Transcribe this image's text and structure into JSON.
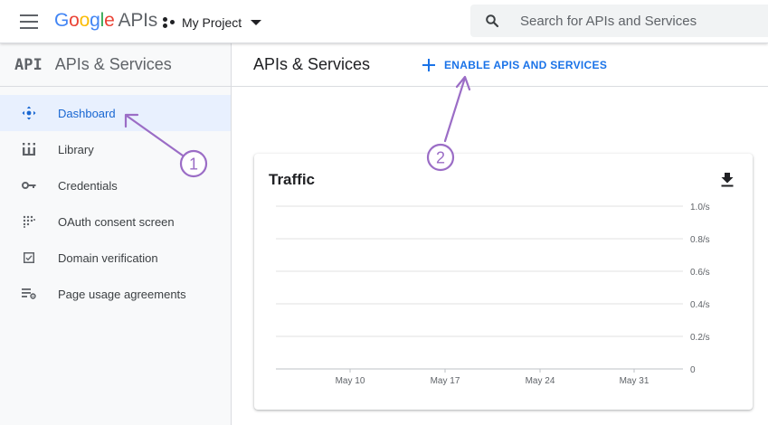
{
  "header": {
    "logo": {
      "letters": [
        "G",
        "o",
        "o",
        "g",
        "l",
        "e"
      ],
      "suffix": "APIs"
    },
    "project": {
      "name": "My Project"
    },
    "search": {
      "placeholder": "Search for APIs and Services",
      "value": ""
    }
  },
  "sidebar": {
    "logo_text": "API",
    "title": "APIs & Services",
    "items": [
      {
        "label": "Dashboard",
        "icon": "dashboard-icon",
        "active": true
      },
      {
        "label": "Library",
        "icon": "library-icon",
        "active": false
      },
      {
        "label": "Credentials",
        "icon": "key-icon",
        "active": false
      },
      {
        "label": "OAuth consent screen",
        "icon": "consent-icon",
        "active": false
      },
      {
        "label": "Domain verification",
        "icon": "checkbox-icon",
        "active": false
      },
      {
        "label": "Page usage agreements",
        "icon": "settings-list-icon",
        "active": false
      }
    ]
  },
  "main": {
    "title": "APIs & Services",
    "enable_button": "ENABLE APIS AND SERVICES"
  },
  "card": {
    "title": "Traffic"
  },
  "annotations": {
    "callout_1": "1",
    "callout_2": "2"
  },
  "colors": {
    "accent": "#1a73e8",
    "active_bg": "#e8f0fe",
    "annotation": "#9b6dc6"
  },
  "chart_data": {
    "type": "line",
    "title": "Traffic",
    "x_tick_labels": [
      "May 10",
      "May 17",
      "May 24",
      "May 31"
    ],
    "y_tick_labels": [
      "0",
      "0.2/s",
      "0.4/s",
      "0.6/s",
      "0.8/s",
      "1.0/s"
    ],
    "y_ticks": [
      0,
      0.2,
      0.4,
      0.6,
      0.8,
      1.0
    ],
    "ylim": [
      0,
      1.0
    ],
    "series": [],
    "grid": true
  }
}
